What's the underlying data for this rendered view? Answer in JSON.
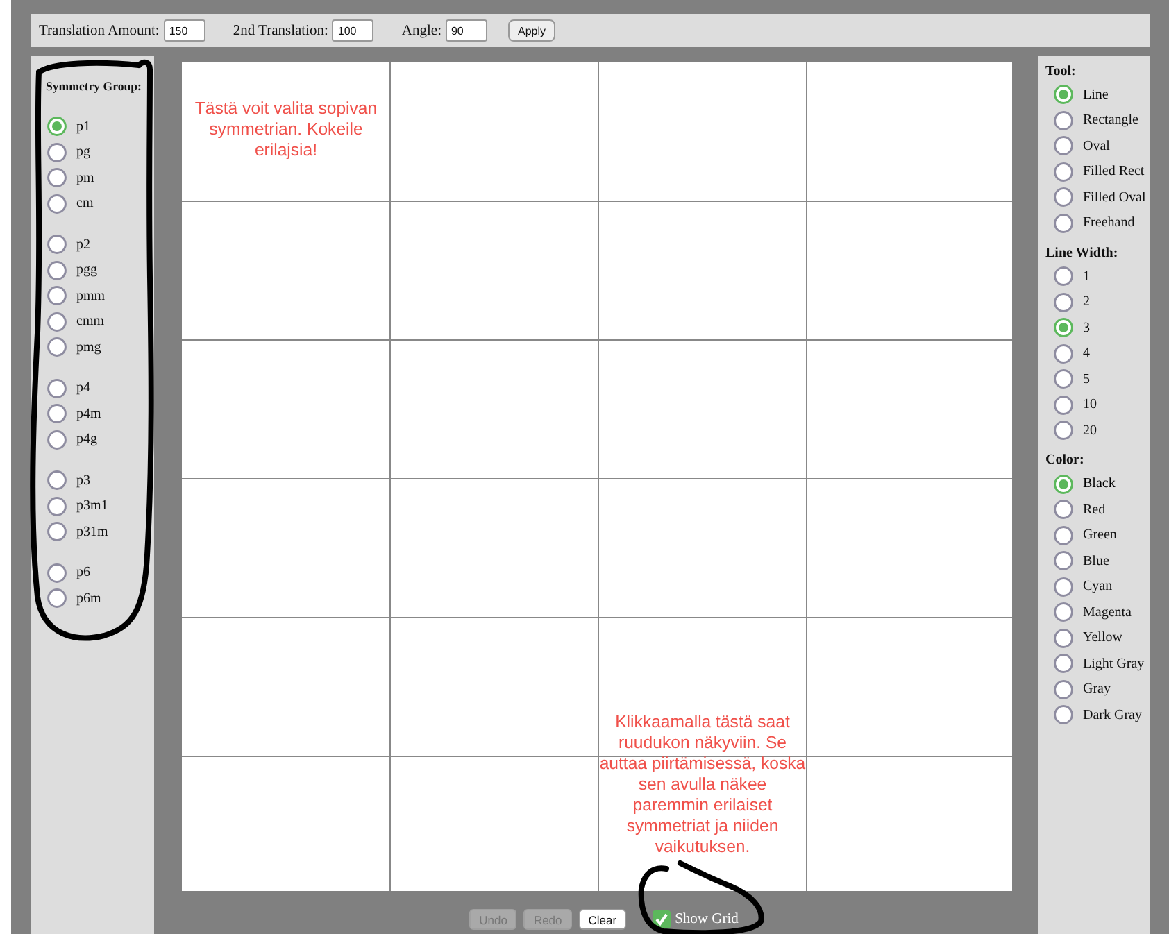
{
  "toolbar": {
    "fields": [
      {
        "label": "Translation Amount:",
        "value": "150"
      },
      {
        "label": "2nd Translation:",
        "value": "100"
      },
      {
        "label": "Angle:",
        "value": "90"
      }
    ],
    "apply_button": "Apply"
  },
  "symmetry_group": {
    "label": "Symmetry Group:",
    "groups": [
      {
        "options": [
          {
            "label": "p1",
            "selected": true
          },
          {
            "label": "pg",
            "selected": false
          },
          {
            "label": "pm",
            "selected": false
          },
          {
            "label": "cm",
            "selected": false
          }
        ]
      },
      {
        "options": [
          {
            "label": "p2",
            "selected": false
          },
          {
            "label": "pgg",
            "selected": false
          },
          {
            "label": "pmm",
            "selected": false
          },
          {
            "label": "cmm",
            "selected": false
          },
          {
            "label": "pmg",
            "selected": false
          }
        ]
      },
      {
        "options": [
          {
            "label": "p4",
            "selected": false
          },
          {
            "label": "p4m",
            "selected": false
          },
          {
            "label": "p4g",
            "selected": false
          }
        ]
      },
      {
        "options": [
          {
            "label": "p3",
            "selected": false
          },
          {
            "label": "p3m1",
            "selected": false
          },
          {
            "label": "p31m",
            "selected": false
          }
        ]
      },
      {
        "options": [
          {
            "label": "p6",
            "selected": false
          },
          {
            "label": "p6m",
            "selected": false
          }
        ]
      }
    ]
  },
  "right_panel": [
    {
      "label": "Tool:",
      "options": [
        {
          "label": "Line",
          "selected": true
        },
        {
          "label": "Rectangle",
          "selected": false
        },
        {
          "label": "Oval",
          "selected": false
        },
        {
          "label": "Filled Rect",
          "selected": false
        },
        {
          "label": "Filled Oval",
          "selected": false
        },
        {
          "label": "Freehand",
          "selected": false
        }
      ]
    },
    {
      "label": "Line Width:",
      "options": [
        {
          "label": "1",
          "selected": false
        },
        {
          "label": "2",
          "selected": false
        },
        {
          "label": "3",
          "selected": true
        },
        {
          "label": "4",
          "selected": false
        },
        {
          "label": "5",
          "selected": false
        },
        {
          "label": "10",
          "selected": false
        },
        {
          "label": "20",
          "selected": false
        }
      ]
    },
    {
      "label": "Color:",
      "options": [
        {
          "label": "Black",
          "selected": true
        },
        {
          "label": "Red",
          "selected": false
        },
        {
          "label": "Green",
          "selected": false
        },
        {
          "label": "Blue",
          "selected": false
        },
        {
          "label": "Cyan",
          "selected": false
        },
        {
          "label": "Magenta",
          "selected": false
        },
        {
          "label": "Yellow",
          "selected": false
        },
        {
          "label": "Light Gray",
          "selected": false
        },
        {
          "label": "Gray",
          "selected": false
        },
        {
          "label": "Dark Gray",
          "selected": false
        }
      ]
    }
  ],
  "annotations": [
    "Tästä voit valita sopivan symmetrian. Kokeile erilajsia!",
    "Klikkaamalla tästä saat ruudukon näkyviin. Se auttaa piirtämisessä, koska sen avulla näkee paremmin erilaiset symmetriat ja niiden vaikutuksen."
  ],
  "bottom_bar": {
    "buttons": [
      {
        "label": "Undo",
        "disabled": true
      },
      {
        "label": "Redo",
        "disabled": true
      },
      {
        "label": "Clear",
        "disabled": false
      }
    ],
    "show_grid": {
      "label": "Show Grid",
      "checked": true
    }
  }
}
